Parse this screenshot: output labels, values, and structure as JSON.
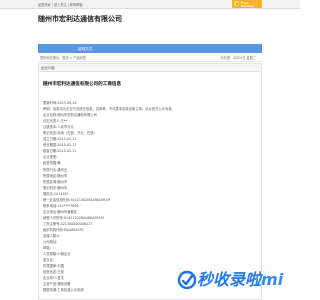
{
  "topbar": {
    "links": "加盟商家 | 进入关注 | 获得邮箱",
    "member_badge": {
      "line1": "Free Member",
      "line2": "免费会员"
    }
  },
  "header": {
    "company_name": "随州市宏利达通信有限公司"
  },
  "nav": {
    "item": "留观方式"
  },
  "breadcrumb": {
    "text": "您的地位置为：首页 > 产品问答",
    "date": "今天是：4月24日 星期二"
  },
  "panel": {
    "title": "企业介绍",
    "article_title": "随州市宏利达通信有限公司的工商信息",
    "lines": [
      "更新时间:2023-08-18",
      "声明：信息均为企业行业提交信息，供参考，不代表本站观点和立场，请以官方公示为准。",
      "企业名称:随州市宏利达通信有限公司",
      "法定代表人:王**",
      "注册资本:人民币万元",
      "登记状态:存续（在营、开业、在册）",
      "成立日期:2015-02-11",
      "营业期限:2015-02-11",
      "核准日期:2015-02-11",
      "企业类型:",
      "经营范围:略",
      "所属行业:通讯业",
      "所属地区:随州市",
      "所属区域:随州市",
      "登记机关:随州市",
      "曾用名:2014567",
      "统一社会信用代码:91421302MA48KA5R1M",
      "联系电话:152****7890",
      "企业地址:随州市曾都区",
      "纳税人识别号:91421302MA48KA5R1M",
      "工商注册号:421300000006423",
      "组织机构代码:MA48KA5R1",
      "参保人数:0",
      "公司网址:",
      "邮箱:",
      "人员规模:小微企业",
      "英文名:",
      "所属国家:中国",
      "经营状态:正常",
      "企业简介:暂无",
      "主营产品:通信设备",
      "数据来源:工商信息公示系统"
    ]
  },
  "watermark": {
    "brand": "秒收录啦",
    "suffix": "mi",
    "color": "#1a73e8"
  }
}
